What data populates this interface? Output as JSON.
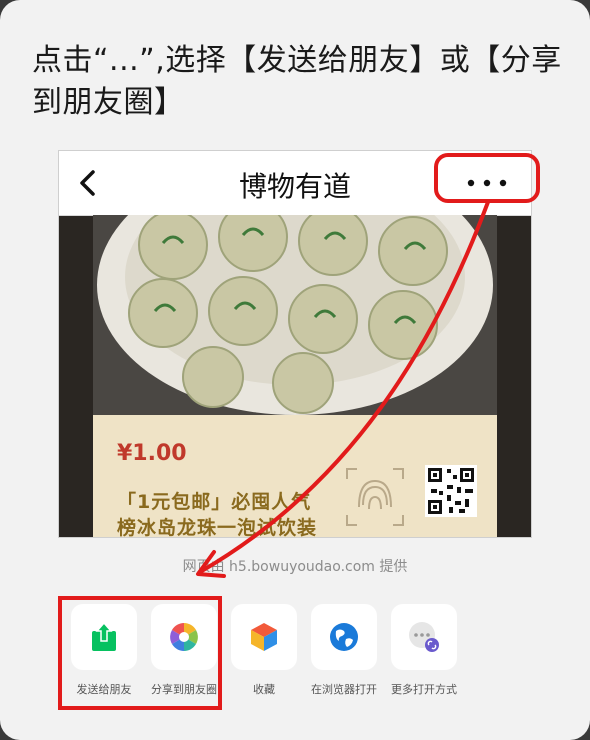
{
  "instruction": {
    "line1": "点击“...”,选择【发送给朋友】或【分享",
    "line2": "到朋友圈】"
  },
  "phone": {
    "nav": {
      "title": "博物有道",
      "back_icon": "chevron-left-icon",
      "more_icon": "more-dots-icon"
    },
    "product": {
      "price": "¥1.00",
      "promo_line1": "「1元包邮」必囤人气",
      "promo_line2": "榜冰岛龙珠一泡试饮装"
    }
  },
  "share_panel": {
    "source_text": "网页由 h5.bowuyoudao.com 提供",
    "items": [
      {
        "label": "发送给朋友",
        "icon": "share-arrow-icon"
      },
      {
        "label": "分享到朋友圈",
        "icon": "moments-icon"
      },
      {
        "label": "收藏",
        "icon": "favorite-cube-icon"
      },
      {
        "label": "在浏览器打开",
        "icon": "browser-globe-icon"
      },
      {
        "label": "更多打开方式",
        "icon": "more-open-icon"
      }
    ]
  },
  "colors": {
    "highlight": "#e21b1b",
    "share_green": "#07c160",
    "browser_blue": "#1a7ad9",
    "price_red": "#c0392b"
  }
}
